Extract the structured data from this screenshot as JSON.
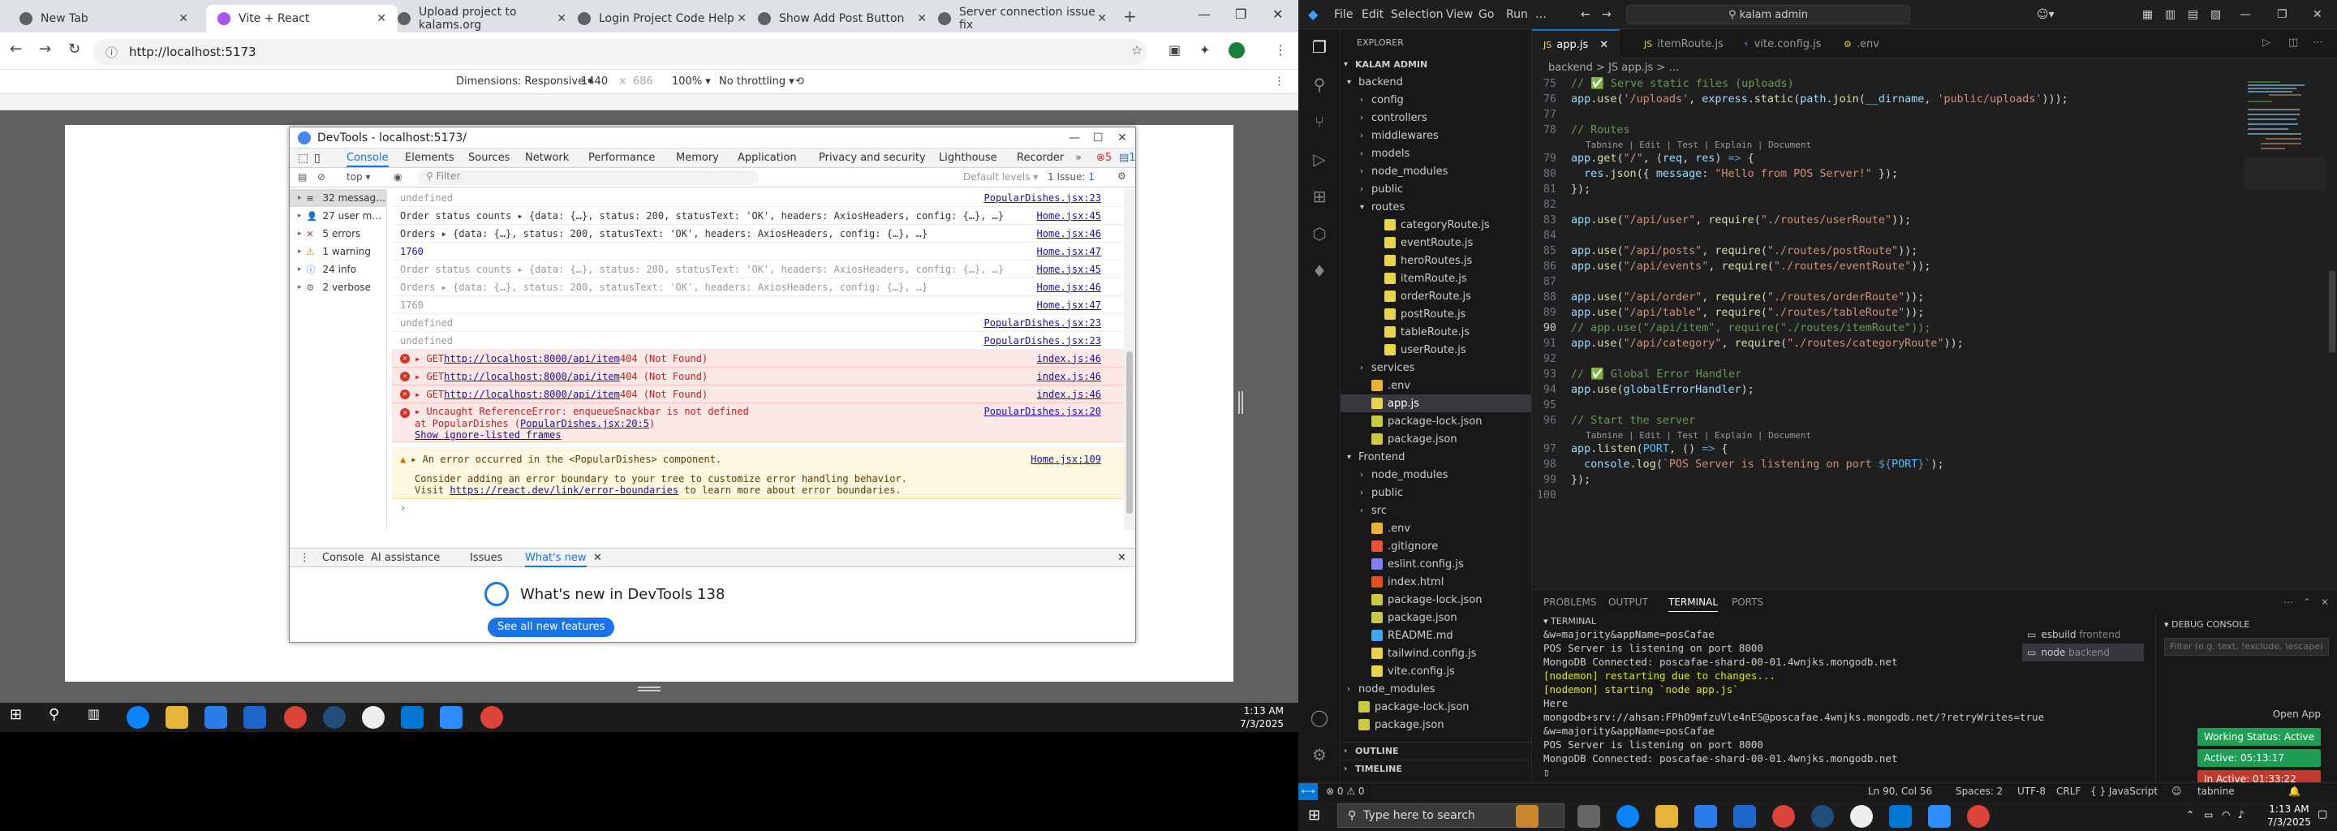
{
  "browser": {
    "tabs": [
      {
        "title": "New Tab"
      },
      {
        "title": "Vite + React"
      },
      {
        "title": "Upload project to kalams.org"
      },
      {
        "title": "Login Project Code Help"
      },
      {
        "title": "Show Add Post Button"
      },
      {
        "title": "Server connection issue fix"
      }
    ],
    "url": "http://localhost:5173",
    "device_toolbar": {
      "dimensions_label": "Dimensions: Responsive ▾",
      "width": "1440",
      "height": "686",
      "zoom": "100% ▾",
      "throttle": "No throttling ▾"
    }
  },
  "devtools": {
    "window_title": "DevTools - localhost:5173/",
    "tabs": [
      "Console",
      "Elements",
      "Sources",
      "Network",
      "Performance",
      "Memory",
      "Application",
      "Privacy and security",
      "Lighthouse",
      "Recorder"
    ],
    "error_count": "5",
    "issue_count": "1",
    "context": "top ▾",
    "filter_placeholder": "Filter",
    "levels": "Default levels ▾",
    "issues_label": "1 Issue: ",
    "issues_num": "1",
    "sidebar": [
      {
        "label": "32 messag…",
        "icon": "≡"
      },
      {
        "label": "27 user m…",
        "icon": "👤"
      },
      {
        "label": "5 errors",
        "icon": "✕"
      },
      {
        "label": "1 warning",
        "icon": "⚠"
      },
      {
        "label": "24 info",
        "icon": "ⓘ"
      },
      {
        "label": "2 verbose",
        "icon": "⚙"
      }
    ],
    "log": [
      {
        "text": "undefined",
        "src": "PopularDishes.jsx:23",
        "kind": "dim"
      },
      {
        "text": "Order status counts  ▸ {data: {…}, status: 200, statusText: 'OK', headers: AxiosHeaders, config: {…}, …}",
        "src": "Home.jsx:45",
        "kind": "normal"
      },
      {
        "text": "Orders  ▸ {data: {…}, status: 200, statusText: 'OK', headers: AxiosHeaders, config: {…}, …}",
        "src": "Home.jsx:46",
        "kind": "normal"
      },
      {
        "text": "1760",
        "src": "Home.jsx:47",
        "kind": "num"
      },
      {
        "text": "Order status counts  ▸ {data: {…}, status: 200, statusText: 'OK', headers: AxiosHeaders, config: {…}, …}",
        "src": "Home.jsx:45",
        "kind": "dim"
      },
      {
        "text": "Orders  ▸ {data: {…}, status: 200, statusText: 'OK', headers: AxiosHeaders, config: {…}, …}",
        "src": "Home.jsx:46",
        "kind": "dim"
      },
      {
        "text": "1760",
        "src": "Home.jsx:47",
        "kind": "dim"
      },
      {
        "text": "undefined",
        "src": "PopularDishes.jsx:23",
        "kind": "dim"
      },
      {
        "text": "undefined",
        "src": "PopularDishes.jsx:23",
        "kind": "dim"
      }
    ],
    "errors": [
      {
        "pre": "▸ GET ",
        "link": "http://localhost:8000/api/item",
        "post": " 404 (Not Found)",
        "src": "index.js:46"
      },
      {
        "pre": "▸ GET ",
        "link": "http://localhost:8000/api/item",
        "post": " 404 (Not Found)",
        "src": "index.js:46"
      },
      {
        "pre": "▸ GET ",
        "link": "http://localhost:8000/api/item",
        "post": " 404 (Not Found)",
        "src": "index.js:46"
      }
    ],
    "uncaught": {
      "line1": "▸ Uncaught ReferenceError: enqueueSnackbar is not defined",
      "line2_pre": "    at PopularDishes (",
      "line2_link": "PopularDishes.jsx:20:5",
      "line2_post": ")",
      "line3": "Show ignore-listed frames",
      "src": "PopularDishes.jsx:20"
    },
    "warning": {
      "line1": "▸ An error occurred in the <PopularDishes> component.",
      "line2": "Consider adding an error boundary to your tree to customize error handling behavior.",
      "line3_pre": "Visit ",
      "line3_link": "https://react.dev/link/error-boundaries",
      "line3_post": " to learn more about error boundaries.",
      "src": "Home.jsx:109"
    },
    "drawer_tabs": [
      "Console",
      "AI assistance",
      "Issues",
      "What's new"
    ],
    "whats_new_title": "What's new in DevTools 138",
    "whats_new_button": "See all new features"
  },
  "taskbar_left": {
    "time": "1:13 AM",
    "date": "7/3/2025"
  },
  "vscode": {
    "menu": [
      "File",
      "Edit",
      "Selection",
      "View",
      "Go",
      "Run",
      "…"
    ],
    "search": "kalam admin",
    "explorer_title": "EXPLORER",
    "workspace": "KALAM ADMIN",
    "tree": [
      {
        "label": "backend",
        "depth": 0,
        "type": "folder-open",
        "color": "#ccc"
      },
      {
        "label": "config",
        "depth": 1,
        "type": "folder",
        "color": "#ccc"
      },
      {
        "label": "controllers",
        "depth": 1,
        "type": "folder",
        "color": "#ccc"
      },
      {
        "label": "middlewares",
        "depth": 1,
        "type": "folder",
        "color": "#ccc"
      },
      {
        "label": "models",
        "depth": 1,
        "type": "folder",
        "color": "#ccc"
      },
      {
        "label": "node_modules",
        "depth": 1,
        "type": "folder",
        "color": "#ccc"
      },
      {
        "label": "public",
        "depth": 1,
        "type": "folder",
        "color": "#ccc"
      },
      {
        "label": "routes",
        "depth": 1,
        "type": "folder-open",
        "color": "#ccc"
      },
      {
        "label": "categoryRoute.js",
        "depth": 2,
        "type": "js",
        "color": "#ccc"
      },
      {
        "label": "eventRoute.js",
        "depth": 2,
        "type": "js",
        "color": "#ccc"
      },
      {
        "label": "heroRoutes.js",
        "depth": 2,
        "type": "js",
        "color": "#ccc"
      },
      {
        "label": "itemRoute.js",
        "depth": 2,
        "type": "js",
        "color": "#ccc"
      },
      {
        "label": "orderRoute.js",
        "depth": 2,
        "type": "js",
        "color": "#ccc"
      },
      {
        "label": "postRoute.js",
        "depth": 2,
        "type": "js",
        "color": "#ccc"
      },
      {
        "label": "tableRoute.js",
        "depth": 2,
        "type": "js",
        "color": "#ccc"
      },
      {
        "label": "userRoute.js",
        "depth": 2,
        "type": "js",
        "color": "#ccc"
      },
      {
        "label": "services",
        "depth": 1,
        "type": "folder",
        "color": "#ccc"
      },
      {
        "label": ".env",
        "depth": 1,
        "type": "env",
        "color": "#ccc"
      },
      {
        "label": "app.js",
        "depth": 1,
        "type": "js",
        "color": "#fff",
        "selected": true
      },
      {
        "label": "package-lock.json",
        "depth": 1,
        "type": "json",
        "color": "#ccc"
      },
      {
        "label": "package.json",
        "depth": 1,
        "type": "json",
        "color": "#ccc"
      },
      {
        "label": "Frontend",
        "depth": 0,
        "type": "folder-open",
        "color": "#ccc"
      },
      {
        "label": "node_modules",
        "depth": 1,
        "type": "folder",
        "color": "#ccc"
      },
      {
        "label": "public",
        "depth": 1,
        "type": "folder",
        "color": "#ccc"
      },
      {
        "label": "src",
        "depth": 1,
        "type": "folder",
        "color": "#ccc"
      },
      {
        "label": ".env",
        "depth": 1,
        "type": "env",
        "color": "#ccc"
      },
      {
        "label": ".gitignore",
        "depth": 1,
        "type": "git",
        "color": "#ccc"
      },
      {
        "label": "eslint.config.js",
        "depth": 1,
        "type": "eslint",
        "color": "#ccc"
      },
      {
        "label": "index.html",
        "depth": 1,
        "type": "html",
        "color": "#ccc"
      },
      {
        "label": "package-lock.json",
        "depth": 1,
        "type": "json",
        "color": "#ccc"
      },
      {
        "label": "package.json",
        "depth": 1,
        "type": "json",
        "color": "#ccc"
      },
      {
        "label": "README.md",
        "depth": 1,
        "type": "md",
        "color": "#ccc"
      },
      {
        "label": "tailwind.config.js",
        "depth": 1,
        "type": "js",
        "color": "#ccc"
      },
      {
        "label": "vite.config.js",
        "depth": 1,
        "type": "js",
        "color": "#ccc"
      },
      {
        "label": "node_modules",
        "depth": 0,
        "type": "folder",
        "color": "#ccc"
      },
      {
        "label": "package-lock.json",
        "depth": 0,
        "type": "json",
        "color": "#ccc"
      },
      {
        "label": "package.json",
        "depth": 0,
        "type": "json",
        "color": "#ccc"
      }
    ],
    "outline": "OUTLINE",
    "timeline": "TIMELINE",
    "editor_tabs": [
      "app.js",
      "itemRoute.js",
      "vite.config.js",
      ".env"
    ],
    "breadcrumb": "backend > JS app.js > …",
    "codelens": "Tabnine | Edit | Test | Explain | Document",
    "code": [
      {
        "ln": "75",
        "html": "<span class='c'>// ✅ Serve static files (uploads)</span>"
      },
      {
        "ln": "76",
        "html": "<span class='v'>app</span><span class='p'>.</span><span class='f'>use</span><span class='p'>(</span><span class='s'>'/uploads'</span><span class='p'>, </span><span class='v'>express</span><span class='p'>.</span><span class='f'>static</span><span class='p'>(</span><span class='v'>path</span><span class='p'>.</span><span class='f'>join</span><span class='p'>(</span><span class='v'>__dirname</span><span class='p'>, </span><span class='s'>'public/uploads'</span><span class='p'>)));</span>"
      },
      {
        "ln": "77",
        "html": ""
      },
      {
        "ln": "78",
        "html": "<span class='c'>// Routes</span>"
      },
      {
        "ln": "lens",
        "html": ""
      },
      {
        "ln": "79",
        "html": "<span class='v'>app</span><span class='p'>.</span><span class='f'>get</span><span class='p'>(</span><span class='s'>\"/\"</span><span class='p'>, (</span><span class='v'>req</span><span class='p'>, </span><span class='v'>res</span><span class='p'>) </span><span class='g'>=&gt;</span><span class='p'> {</span>"
      },
      {
        "ln": "80",
        "html": "  <span class='v'>res</span><span class='p'>.</span><span class='f'>json</span><span class='p'>({ </span><span class='v'>message</span><span class='p'>: </span><span class='s'>\"Hello from POS Server!\"</span><span class='p'> });</span>"
      },
      {
        "ln": "81",
        "html": "<span class='p'>});</span>"
      },
      {
        "ln": "82",
        "html": ""
      },
      {
        "ln": "83",
        "html": "<span class='v'>app</span><span class='p'>.</span><span class='f'>use</span><span class='p'>(</span><span class='s'>\"/api/user\"</span><span class='p'>, </span><span class='f'>require</span><span class='p'>(</span><span class='s'>\"./routes/userRoute\"</span><span class='p'>));</span>"
      },
      {
        "ln": "84",
        "html": ""
      },
      {
        "ln": "85",
        "html": "<span class='v'>app</span><span class='p'>.</span><span class='f'>use</span><span class='p'>(</span><span class='s'>\"/api/posts\"</span><span class='p'>, </span><span class='f'>require</span><span class='p'>(</span><span class='s'>\"./routes/postRoute\"</span><span class='p'>));</span>"
      },
      {
        "ln": "86",
        "html": "<span class='v'>app</span><span class='p'>.</span><span class='f'>use</span><span class='p'>(</span><span class='s'>\"/api/events\"</span><span class='p'>, </span><span class='f'>require</span><span class='p'>(</span><span class='s'>\"./routes/eventRoute\"</span><span class='p'>));</span>"
      },
      {
        "ln": "87",
        "html": ""
      },
      {
        "ln": "88",
        "html": "<span class='v'>app</span><span class='p'>.</span><span class='f'>use</span><span class='p'>(</span><span class='s'>\"/api/order\"</span><span class='p'>, </span><span class='f'>require</span><span class='p'>(</span><span class='s'>\"./routes/orderRoute\"</span><span class='p'>));</span>"
      },
      {
        "ln": "89",
        "html": "<span class='v'>app</span><span class='p'>.</span><span class='f'>use</span><span class='p'>(</span><span class='s'>\"/api/table\"</span><span class='p'>, </span><span class='f'>require</span><span class='p'>(</span><span class='s'>\"./routes/tableRoute\"</span><span class='p'>));</span>"
      },
      {
        "ln": "90",
        "html": "<span class='c'>// app.use(\"/api/item\", require(\"./routes/itemRoute\"));</span>",
        "cur": true
      },
      {
        "ln": "91",
        "html": "<span class='v'>app</span><span class='p'>.</span><span class='f'>use</span><span class='p'>(</span><span class='s'>\"/api/category\"</span><span class='p'>, </span><span class='f'>require</span><span class='p'>(</span><span class='s'>\"./routes/categoryRoute\"</span><span class='p'>));</span>"
      },
      {
        "ln": "92",
        "html": ""
      },
      {
        "ln": "93",
        "html": "<span class='c'>// ✅ Global Error Handler</span>"
      },
      {
        "ln": "94",
        "html": "<span class='v'>app</span><span class='p'>.</span><span class='f'>use</span><span class='p'>(</span><span class='v'>globalErrorHandler</span><span class='p'>);</span>"
      },
      {
        "ln": "95",
        "html": ""
      },
      {
        "ln": "96",
        "html": "<span class='c'>// Start the server</span>"
      },
      {
        "ln": "lens",
        "html": ""
      },
      {
        "ln": "97",
        "html": "<span class='v'>app</span><span class='p'>.</span><span class='f'>listen</span><span class='p'>(</span><span class='n'>PORT</span><span class='p'>, () </span><span class='g'>=&gt;</span><span class='p'> {</span>"
      },
      {
        "ln": "98",
        "html": "  <span class='v'>console</span><span class='p'>.</span><span class='f'>log</span><span class='p'>(</span><span class='s'>`POS Server is listening on port </span><span class='g'>${</span><span class='n'>PORT</span><span class='g'>}</span><span class='s'>`</span><span class='p'>);</span>"
      },
      {
        "ln": "99",
        "html": "<span class='p'>});</span>"
      },
      {
        "ln": "100",
        "html": ""
      }
    ],
    "panel_tabs": [
      "PROBLEMS",
      "OUTPUT",
      "TERMINAL",
      "PORTS"
    ],
    "panel_section": "TERMINAL",
    "terminal": [
      {
        "t": "&w=majority&appName=posCafae",
        "y": false
      },
      {
        "t": "POS Server is listening on port 8000",
        "y": false
      },
      {
        "t": "MongoDB Connected: poscafae-shard-00-01.4wnjks.mongodb.net",
        "y": false
      },
      {
        "t": "[nodemon] restarting due to changes...",
        "y": true
      },
      {
        "t": "[nodemon] starting `node app.js`",
        "y": true
      },
      {
        "t": "Here",
        "y": false
      },
      {
        "t": "mongodb+srv://ahsan:FPhO9mfzuVle4nES@poscafae.4wnjks.mongodb.net/?retryWrites=true",
        "y": false
      },
      {
        "t": "&w=majority&appName=posCafae",
        "y": false
      },
      {
        "t": "POS Server is listening on port 8000",
        "y": false
      },
      {
        "t": "MongoDB Connected: poscafae-shard-00-01.4wnjks.mongodb.net",
        "y": false
      }
    ],
    "term_list": [
      {
        "label": "esbuild",
        "sub": "frontend"
      },
      {
        "label": "node",
        "sub": "backend"
      }
    ],
    "debug_title": "DEBUG CONSOLE",
    "debug_filter": "Filter (e.g. text, !exclude, \\escape)",
    "open_app": "Open App",
    "status_pills": [
      {
        "text": "Working Status: Active",
        "color": "#1f9d55"
      },
      {
        "text": "Active: 05:13:17",
        "color": "#1f9d55"
      },
      {
        "text": "In Active: 01:33:22",
        "color": "#c0392b"
      }
    ],
    "status": {
      "left": "⊗ 0 ⚠ 0",
      "position": "Ln 90, Col 56",
      "spaces": "Spaces: 2",
      "encoding": "UTF-8",
      "eol": "CRLF",
      "lang": "{ } JavaScript",
      "tabnine": "tabnine"
    }
  },
  "taskbar_right": {
    "search": "Type here to search",
    "time": "1:13 AM",
    "date": "7/3/2025"
  }
}
